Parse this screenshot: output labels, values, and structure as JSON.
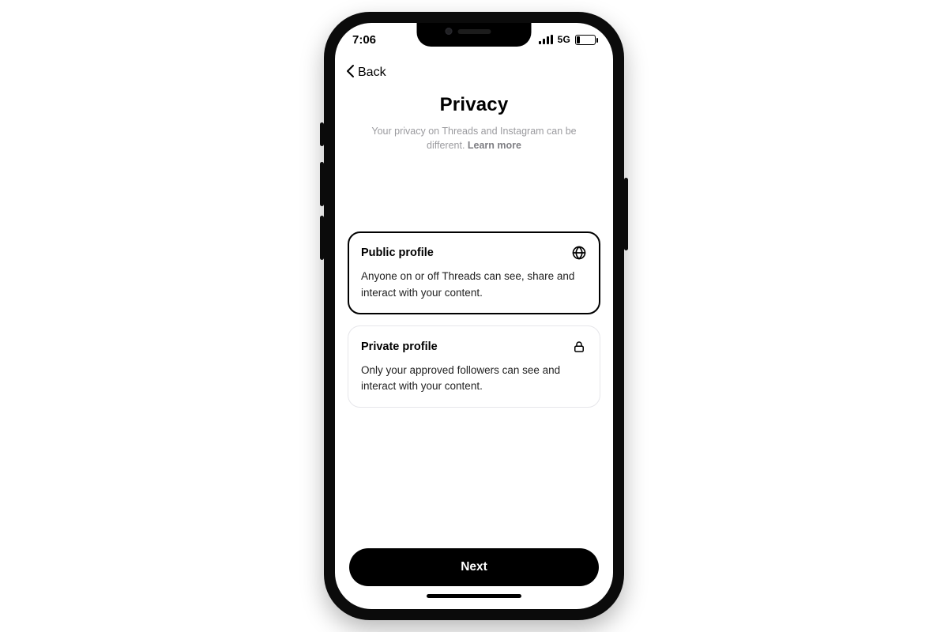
{
  "statusbar": {
    "time": "7:06",
    "network": "5G"
  },
  "nav": {
    "back_label": "Back"
  },
  "header": {
    "title": "Privacy",
    "subtitle": "Your privacy on Threads and Instagram can be different. ",
    "learn_more": "Learn more"
  },
  "options": [
    {
      "title": "Public profile",
      "desc": "Anyone on or off Threads can see, share and interact with your content.",
      "selected": true,
      "icon": "globe-icon"
    },
    {
      "title": "Private profile",
      "desc": "Only your approved followers can see and interact with your content.",
      "selected": false,
      "icon": "lock-icon"
    }
  ],
  "footer": {
    "next_label": "Next"
  }
}
